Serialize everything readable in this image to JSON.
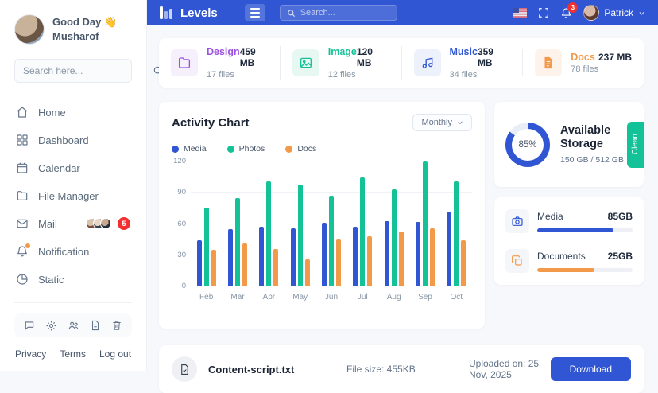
{
  "sidebar": {
    "greeting": "Good Day 👋",
    "username": "Musharof",
    "search_placeholder": "Search here...",
    "nav": [
      {
        "label": "Home",
        "icon": "home"
      },
      {
        "label": "Dashboard",
        "icon": "grid"
      },
      {
        "label": "Calendar",
        "icon": "calendar"
      },
      {
        "label": "File Manager",
        "icon": "folder"
      },
      {
        "label": "Mail",
        "icon": "mail",
        "badge": "5"
      },
      {
        "label": "Notification",
        "icon": "bell"
      },
      {
        "label": "Static",
        "icon": "pie-chart"
      }
    ],
    "footer_links": {
      "privacy": "Privacy",
      "terms": "Terms",
      "logout": "Log out"
    }
  },
  "header": {
    "brand": "Levels",
    "search_placeholder": "Search...",
    "notification_count": "3",
    "user_name": "Patrick",
    "accent_color": "#3056D3"
  },
  "stats": [
    {
      "label": "Design",
      "size": "459 MB",
      "files": "17 files",
      "color": "#9B51E0",
      "icon": "folder"
    },
    {
      "label": "Image",
      "size": "120 MB",
      "files": "12 files",
      "color": "#13C296",
      "icon": "image"
    },
    {
      "label": "Music",
      "size": "359 MB",
      "files": "34 files",
      "color": "#3056D3",
      "icon": "music-note"
    },
    {
      "label": "Docs",
      "size": "237 MB",
      "files": "78 files",
      "color": "#F2994A",
      "icon": "document"
    }
  ],
  "activity": {
    "title": "Activity Chart",
    "period": "Monthly"
  },
  "chart_data": {
    "type": "bar",
    "title": "Activity Chart",
    "categories": [
      "Feb",
      "Mar",
      "Apr",
      "May",
      "Jun",
      "Jul",
      "Aug",
      "Sep",
      "Oct"
    ],
    "series": [
      {
        "name": "Media",
        "color": "#3056D3",
        "values": [
          44,
          55,
          57,
          56,
          61,
          57,
          63,
          62,
          71
        ]
      },
      {
        "name": "Photos",
        "color": "#13C296",
        "values": [
          76,
          85,
          101,
          98,
          87,
          105,
          93,
          120,
          101
        ]
      },
      {
        "name": "Docs",
        "color": "#F2994A",
        "values": [
          35,
          41,
          36,
          26,
          45,
          48,
          53,
          56,
          44
        ]
      }
    ],
    "ylim": [
      0,
      120
    ],
    "yticks": [
      0,
      30,
      60,
      90,
      120
    ],
    "grid": true,
    "legend_position": "top-left"
  },
  "storage": {
    "percent": "85%",
    "percent_value": 85,
    "title": "Available Storage",
    "usage": "150 GB / 512 GB",
    "clean_label": "Clean",
    "ring_color": "#3056D3"
  },
  "usage_bars": [
    {
      "label": "Media",
      "value": "85GB",
      "percent": 80,
      "color": "#3056D3",
      "icon": "camera"
    },
    {
      "label": "Documents",
      "value": "25GB",
      "percent": 60,
      "color": "#F2994A",
      "icon": "copy"
    }
  ],
  "file_row": {
    "name": "Content-script.txt",
    "size_label": "File size: 455KB",
    "uploaded_label": "Uploaded on: 25 Nov, 2025",
    "download_label": "Download"
  }
}
